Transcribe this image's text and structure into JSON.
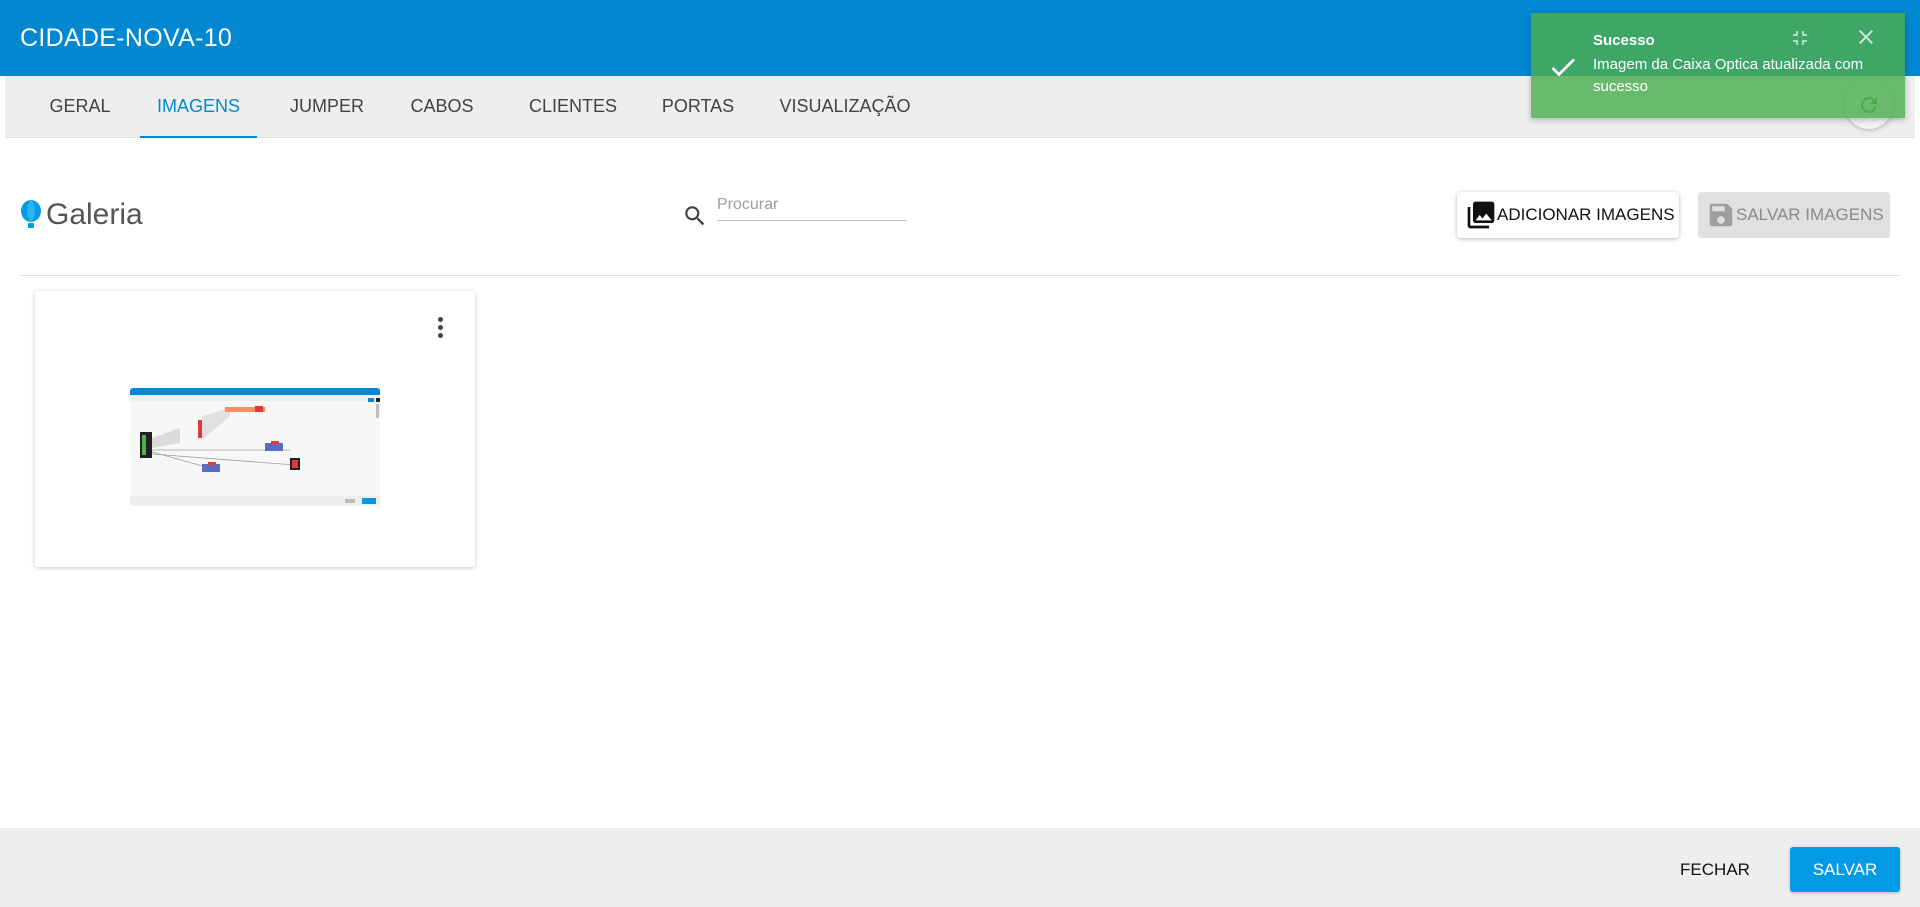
{
  "header": {
    "title": "CIDADE-NOVA-10"
  },
  "tabs": [
    {
      "label": "GERAL"
    },
    {
      "label": "IMAGENS",
      "active": true
    },
    {
      "label": "JUMPER"
    },
    {
      "label": "CABOS"
    },
    {
      "label": "CLIENTES"
    },
    {
      "label": "PORTAS"
    },
    {
      "label": "VISUALIZAÇÃO"
    }
  ],
  "gallery": {
    "title": "Galeria",
    "icon": "balloon-icon",
    "search_placeholder": "Procurar",
    "search_value": "",
    "add_button": "ADICIONAR IMAGENS",
    "save_button": "SALVAR IMAGENS",
    "save_button_disabled": true
  },
  "footer": {
    "close_label": "FECHAR",
    "save_label": "SALVAR"
  },
  "toast": {
    "title": "Sucesso",
    "message": "Imagem da Caixa Optica atualizada com sucesso",
    "color": "#4caf50"
  },
  "colors": {
    "primary": "#0288d1",
    "accent": "#039be5",
    "success": "#4caf50"
  }
}
